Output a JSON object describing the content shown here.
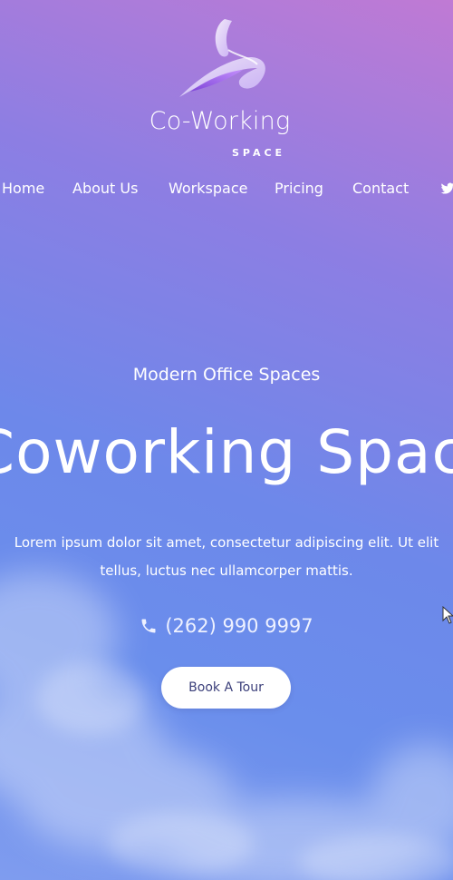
{
  "brand": {
    "title": "Co-Working",
    "subtitle": "SPACE",
    "logo_icon": "abstract-swirl-logo-icon"
  },
  "nav": {
    "items": [
      {
        "label": "Home"
      },
      {
        "label": "About Us"
      },
      {
        "label": "Workspace"
      },
      {
        "label": "Pricing"
      },
      {
        "label": "Contact"
      }
    ],
    "social_icon": "twitter-icon"
  },
  "hero": {
    "kicker": "Modern Office Spaces",
    "headline": "Coworking Space",
    "body_line1": "Lorem ipsum dolor sit amet, consectetur adipiscing elit. Ut elit",
    "body_line2": "tellus, luctus nec ullamcorper mattis.",
    "phone_icon": "phone-icon",
    "phone": "(262) 990 9997",
    "cta_label": "Book A Tour"
  },
  "colors": {
    "gradient_top": "#c07ad4",
    "gradient_mid": "#6d88ea",
    "text": "#ffffff",
    "cta_background": "#ffffff",
    "cta_text": "#3b3f7a"
  }
}
